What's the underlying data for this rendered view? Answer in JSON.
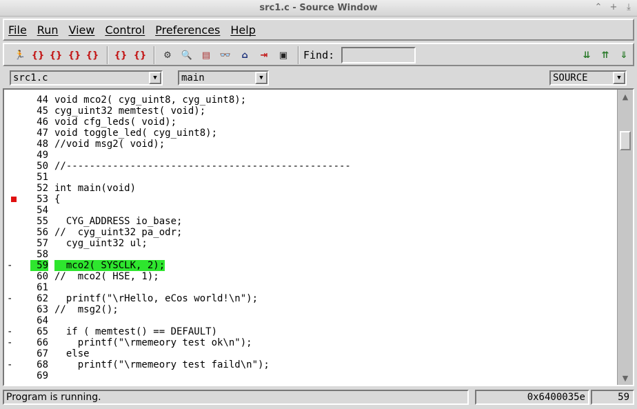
{
  "window": {
    "title": "src1.c - Source Window",
    "buttons": [
      "⌃",
      "+",
      "⤓"
    ]
  },
  "menubar": {
    "items": [
      "File",
      "Run",
      "View",
      "Control",
      "Preferences",
      "Help"
    ]
  },
  "toolbar": {
    "find_label": "Find:",
    "find_value": "",
    "buttons": [
      {
        "name": "run-icon",
        "glyph": "🏃"
      },
      {
        "name": "step-icon",
        "glyph": "{}"
      },
      {
        "name": "next-icon",
        "glyph": "{}"
      },
      {
        "name": "finish-icon",
        "glyph": "{}"
      },
      {
        "name": "continue-icon",
        "glyph": "{}"
      },
      {
        "name": "stepi-icon",
        "glyph": "{}"
      },
      {
        "name": "nexti-icon",
        "glyph": "{}"
      },
      {
        "name": "registers-icon",
        "glyph": "⚙"
      },
      {
        "name": "memory-icon",
        "glyph": "🔍"
      },
      {
        "name": "stack-icon",
        "glyph": "▤"
      },
      {
        "name": "watch-icon",
        "glyph": "👓"
      },
      {
        "name": "locals-icon",
        "glyph": "⌂"
      },
      {
        "name": "breakpoints-icon",
        "glyph": "⇥"
      },
      {
        "name": "console-icon",
        "glyph": "▣"
      },
      {
        "name": "frame-down-icon",
        "glyph": "⇊"
      },
      {
        "name": "frame-up-icon",
        "glyph": "⇈"
      },
      {
        "name": "frame-bottom-icon",
        "glyph": "⇓"
      }
    ]
  },
  "combos": {
    "file": "src1.c",
    "function": "main",
    "mode": "SOURCE"
  },
  "code_lines": [
    {
      "num": "44",
      "text": "void mco2( cyg_uint8, cyg_uint8);",
      "gutter": ""
    },
    {
      "num": "45",
      "text": "cyg_uint32 memtest( void);",
      "gutter": ""
    },
    {
      "num": "46",
      "text": "void cfg_leds( void);",
      "gutter": ""
    },
    {
      "num": "47",
      "text": "void toggle_led( cyg_uint8);",
      "gutter": ""
    },
    {
      "num": "48",
      "text": "//void msg2( void);",
      "gutter": ""
    },
    {
      "num": "49",
      "text": "",
      "gutter": ""
    },
    {
      "num": "50",
      "text": "//-------------------------------------------------",
      "gutter": ""
    },
    {
      "num": "51",
      "text": "",
      "gutter": ""
    },
    {
      "num": "52",
      "text": "int main(void)",
      "gutter": ""
    },
    {
      "num": "53",
      "text": "{",
      "gutter": "bp"
    },
    {
      "num": "54",
      "text": "",
      "gutter": ""
    },
    {
      "num": "55",
      "text": "  CYG_ADDRESS io_base;",
      "gutter": ""
    },
    {
      "num": "56",
      "text": "//  cyg_uint32 pa_odr;",
      "gutter": ""
    },
    {
      "num": "57",
      "text": "  cyg_uint32 ul;",
      "gutter": ""
    },
    {
      "num": "58",
      "text": "",
      "gutter": ""
    },
    {
      "num": "59",
      "text": "  mco2( SYSCLK, 2);",
      "gutter": "-",
      "highlight": true
    },
    {
      "num": "60",
      "text": "//  mco2( HSE, 1);",
      "gutter": ""
    },
    {
      "num": "61",
      "text": "",
      "gutter": ""
    },
    {
      "num": "62",
      "text": "  printf(\"\\rHello, eCos world!\\n\");",
      "gutter": "-"
    },
    {
      "num": "63",
      "text": "//  msg2();",
      "gutter": ""
    },
    {
      "num": "64",
      "text": "",
      "gutter": ""
    },
    {
      "num": "65",
      "text": "  if ( memtest() == DEFAULT)",
      "gutter": "-"
    },
    {
      "num": "66",
      "text": "    printf(\"\\rmemeory test ok\\n\");",
      "gutter": "-"
    },
    {
      "num": "67",
      "text": "  else",
      "gutter": ""
    },
    {
      "num": "68",
      "text": "    printf(\"\\rmemeory test faild\\n\");",
      "gutter": "-"
    },
    {
      "num": "69",
      "text": "",
      "gutter": ""
    }
  ],
  "status": {
    "message": "Program is running.",
    "address": "0x6400035e",
    "line": "59"
  },
  "colors": {
    "highlight": "#2ee62e",
    "breakpoint": "#e01010"
  }
}
